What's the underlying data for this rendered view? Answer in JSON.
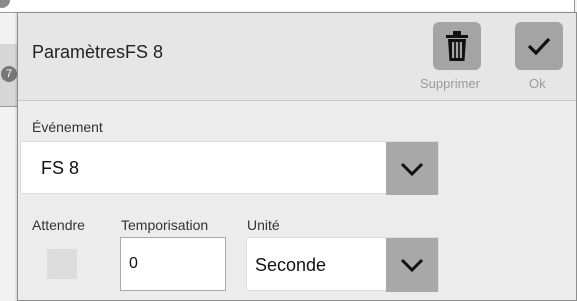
{
  "background": {
    "top_badge": "",
    "row_badge": "7"
  },
  "dialog": {
    "title": "ParamètresFS 8",
    "actions": {
      "delete_label": "Supprimer",
      "ok_label": "Ok",
      "delete_icon": "trash-icon",
      "ok_icon": "check-icon"
    },
    "event": {
      "label": "Événement",
      "value": "FS 8"
    },
    "wait": {
      "label": "Attendre",
      "checked": false
    },
    "timer": {
      "label": "Temporisation",
      "value": "0"
    },
    "unit": {
      "label": "Unité",
      "value": "Seconde"
    }
  },
  "colors": {
    "button_gray": "#a4a4a4",
    "dialog_bg": "#ececec",
    "header_bg": "#e6e6e6",
    "label_disabled": "#9a9a9a"
  }
}
